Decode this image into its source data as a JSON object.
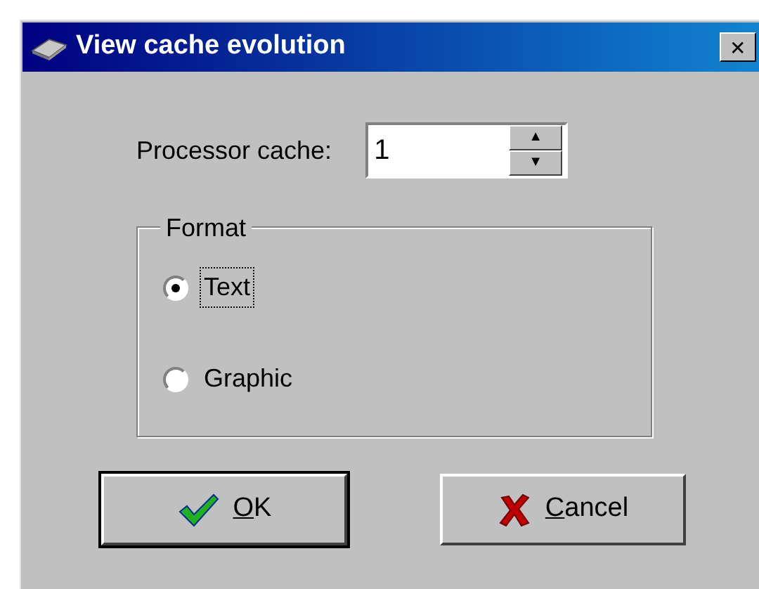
{
  "window": {
    "title": "View cache evolution",
    "close": "✕"
  },
  "processor_cache": {
    "label": "Processor cache:",
    "value": "1",
    "up": "▲",
    "down": "▼"
  },
  "format": {
    "title": "Format",
    "options": [
      {
        "label": "Text",
        "selected": true,
        "focused": true
      },
      {
        "label": "Graphic",
        "selected": false,
        "focused": false
      }
    ]
  },
  "buttons": [
    {
      "kind": "ok",
      "label": "OK",
      "default": true,
      "mnemonic_underlined": true
    },
    {
      "kind": "cancel",
      "label": "Cancel",
      "default": false,
      "mnemonic_underlined": true
    }
  ]
}
